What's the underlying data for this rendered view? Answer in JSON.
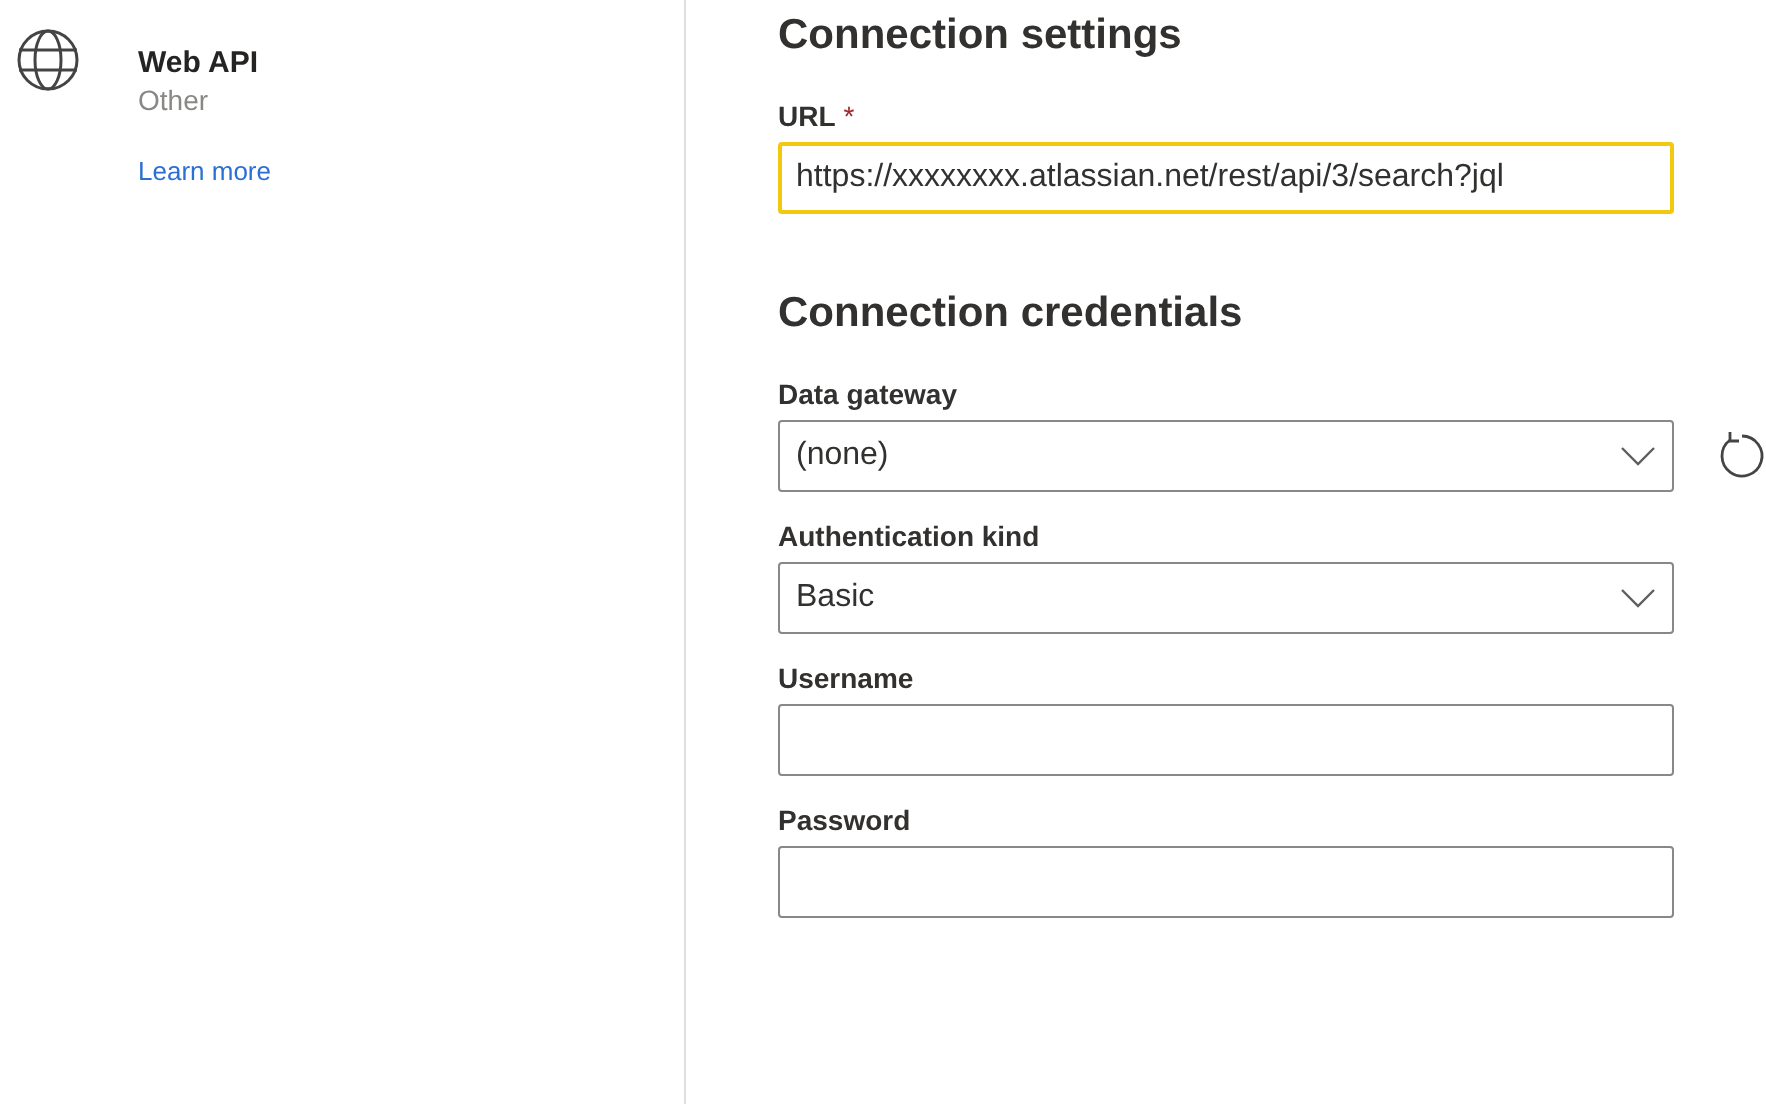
{
  "connector": {
    "title": "Web API",
    "category": "Other",
    "link": "Learn more"
  },
  "sections": [
    {
      "heading": "Connection settings",
      "fields": [
        {
          "label": "URL",
          "required_mark": "*",
          "kind": "text",
          "value": "https://xxxxxxxx.atlassian.net/rest/api/3/search?jql",
          "focused": true,
          "refresh": false
        }
      ]
    },
    {
      "heading": "Connection credentials",
      "fields": [
        {
          "label": "Data gateway",
          "kind": "dropdown",
          "value": "(none)",
          "focused": false,
          "refresh": true
        },
        {
          "label": "Authentication kind",
          "kind": "dropdown",
          "value": "Basic",
          "focused": false,
          "refresh": false
        },
        {
          "label": "Username",
          "kind": "text",
          "focused": false,
          "refresh": false
        },
        {
          "label": "Password",
          "kind": "text",
          "focused": false,
          "refresh": false
        }
      ]
    }
  ]
}
